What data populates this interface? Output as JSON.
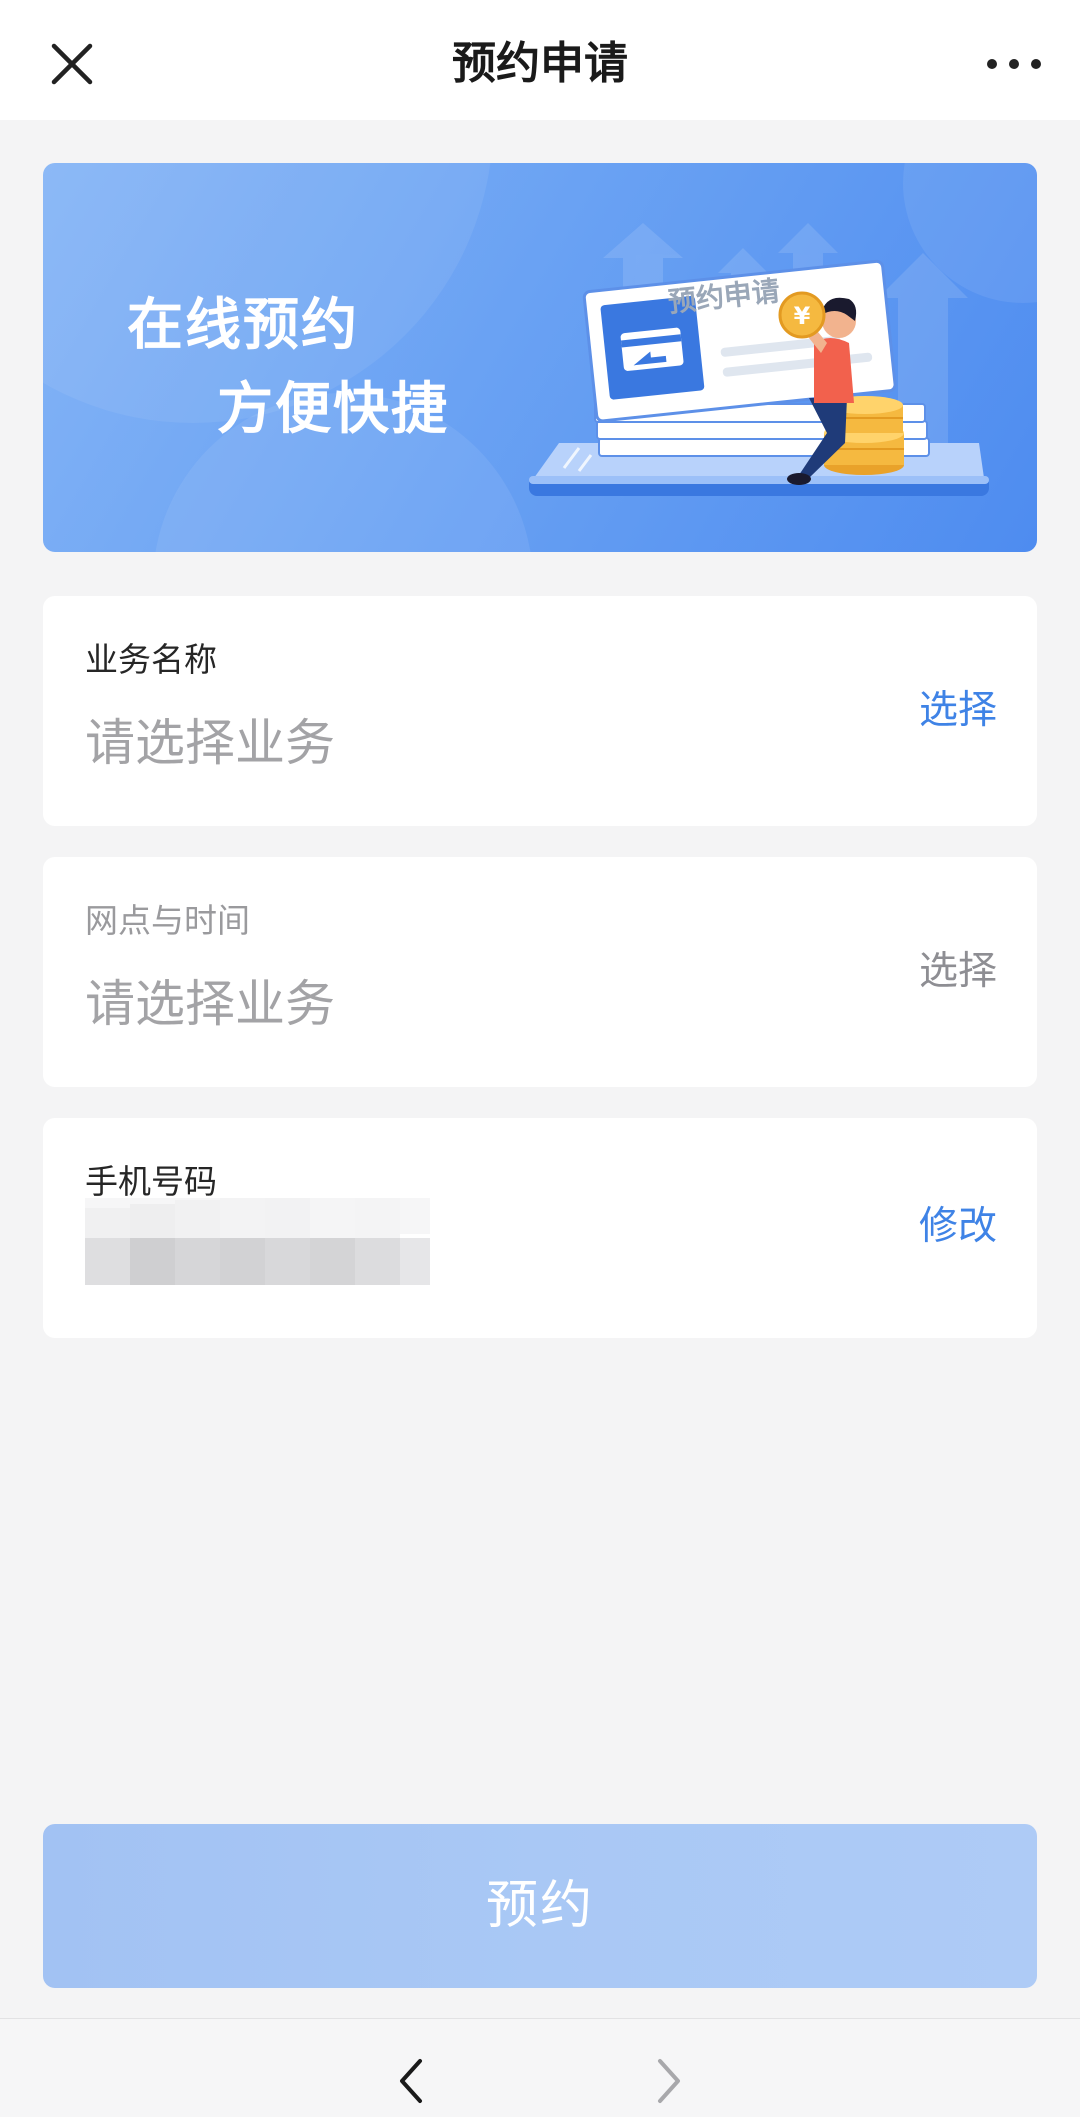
{
  "navbar": {
    "title": "预约申请",
    "close_icon": "close-icon",
    "more_icon": "more-dots-icon"
  },
  "banner": {
    "line1": "在线预约",
    "line2": "方便快捷",
    "illustration_label": "预约申请",
    "illustration_coin": "¥"
  },
  "form": {
    "business": {
      "label": "业务名称",
      "placeholder": "请选择业务",
      "action": "选择"
    },
    "branch_time": {
      "label": "网点与时间",
      "placeholder": "请选择业务",
      "action": "选择"
    },
    "phone": {
      "label": "手机号码",
      "action": "修改"
    }
  },
  "submit": {
    "label": "预约"
  },
  "toolbar": {
    "back_icon": "chevron-left-icon",
    "forward_icon": "chevron-right-icon"
  },
  "colors": {
    "accent": "#3f83e6",
    "disabled_button": "#a9c8f5",
    "muted_text": "#a3a3a6",
    "page_bg": "#f4f4f5"
  }
}
